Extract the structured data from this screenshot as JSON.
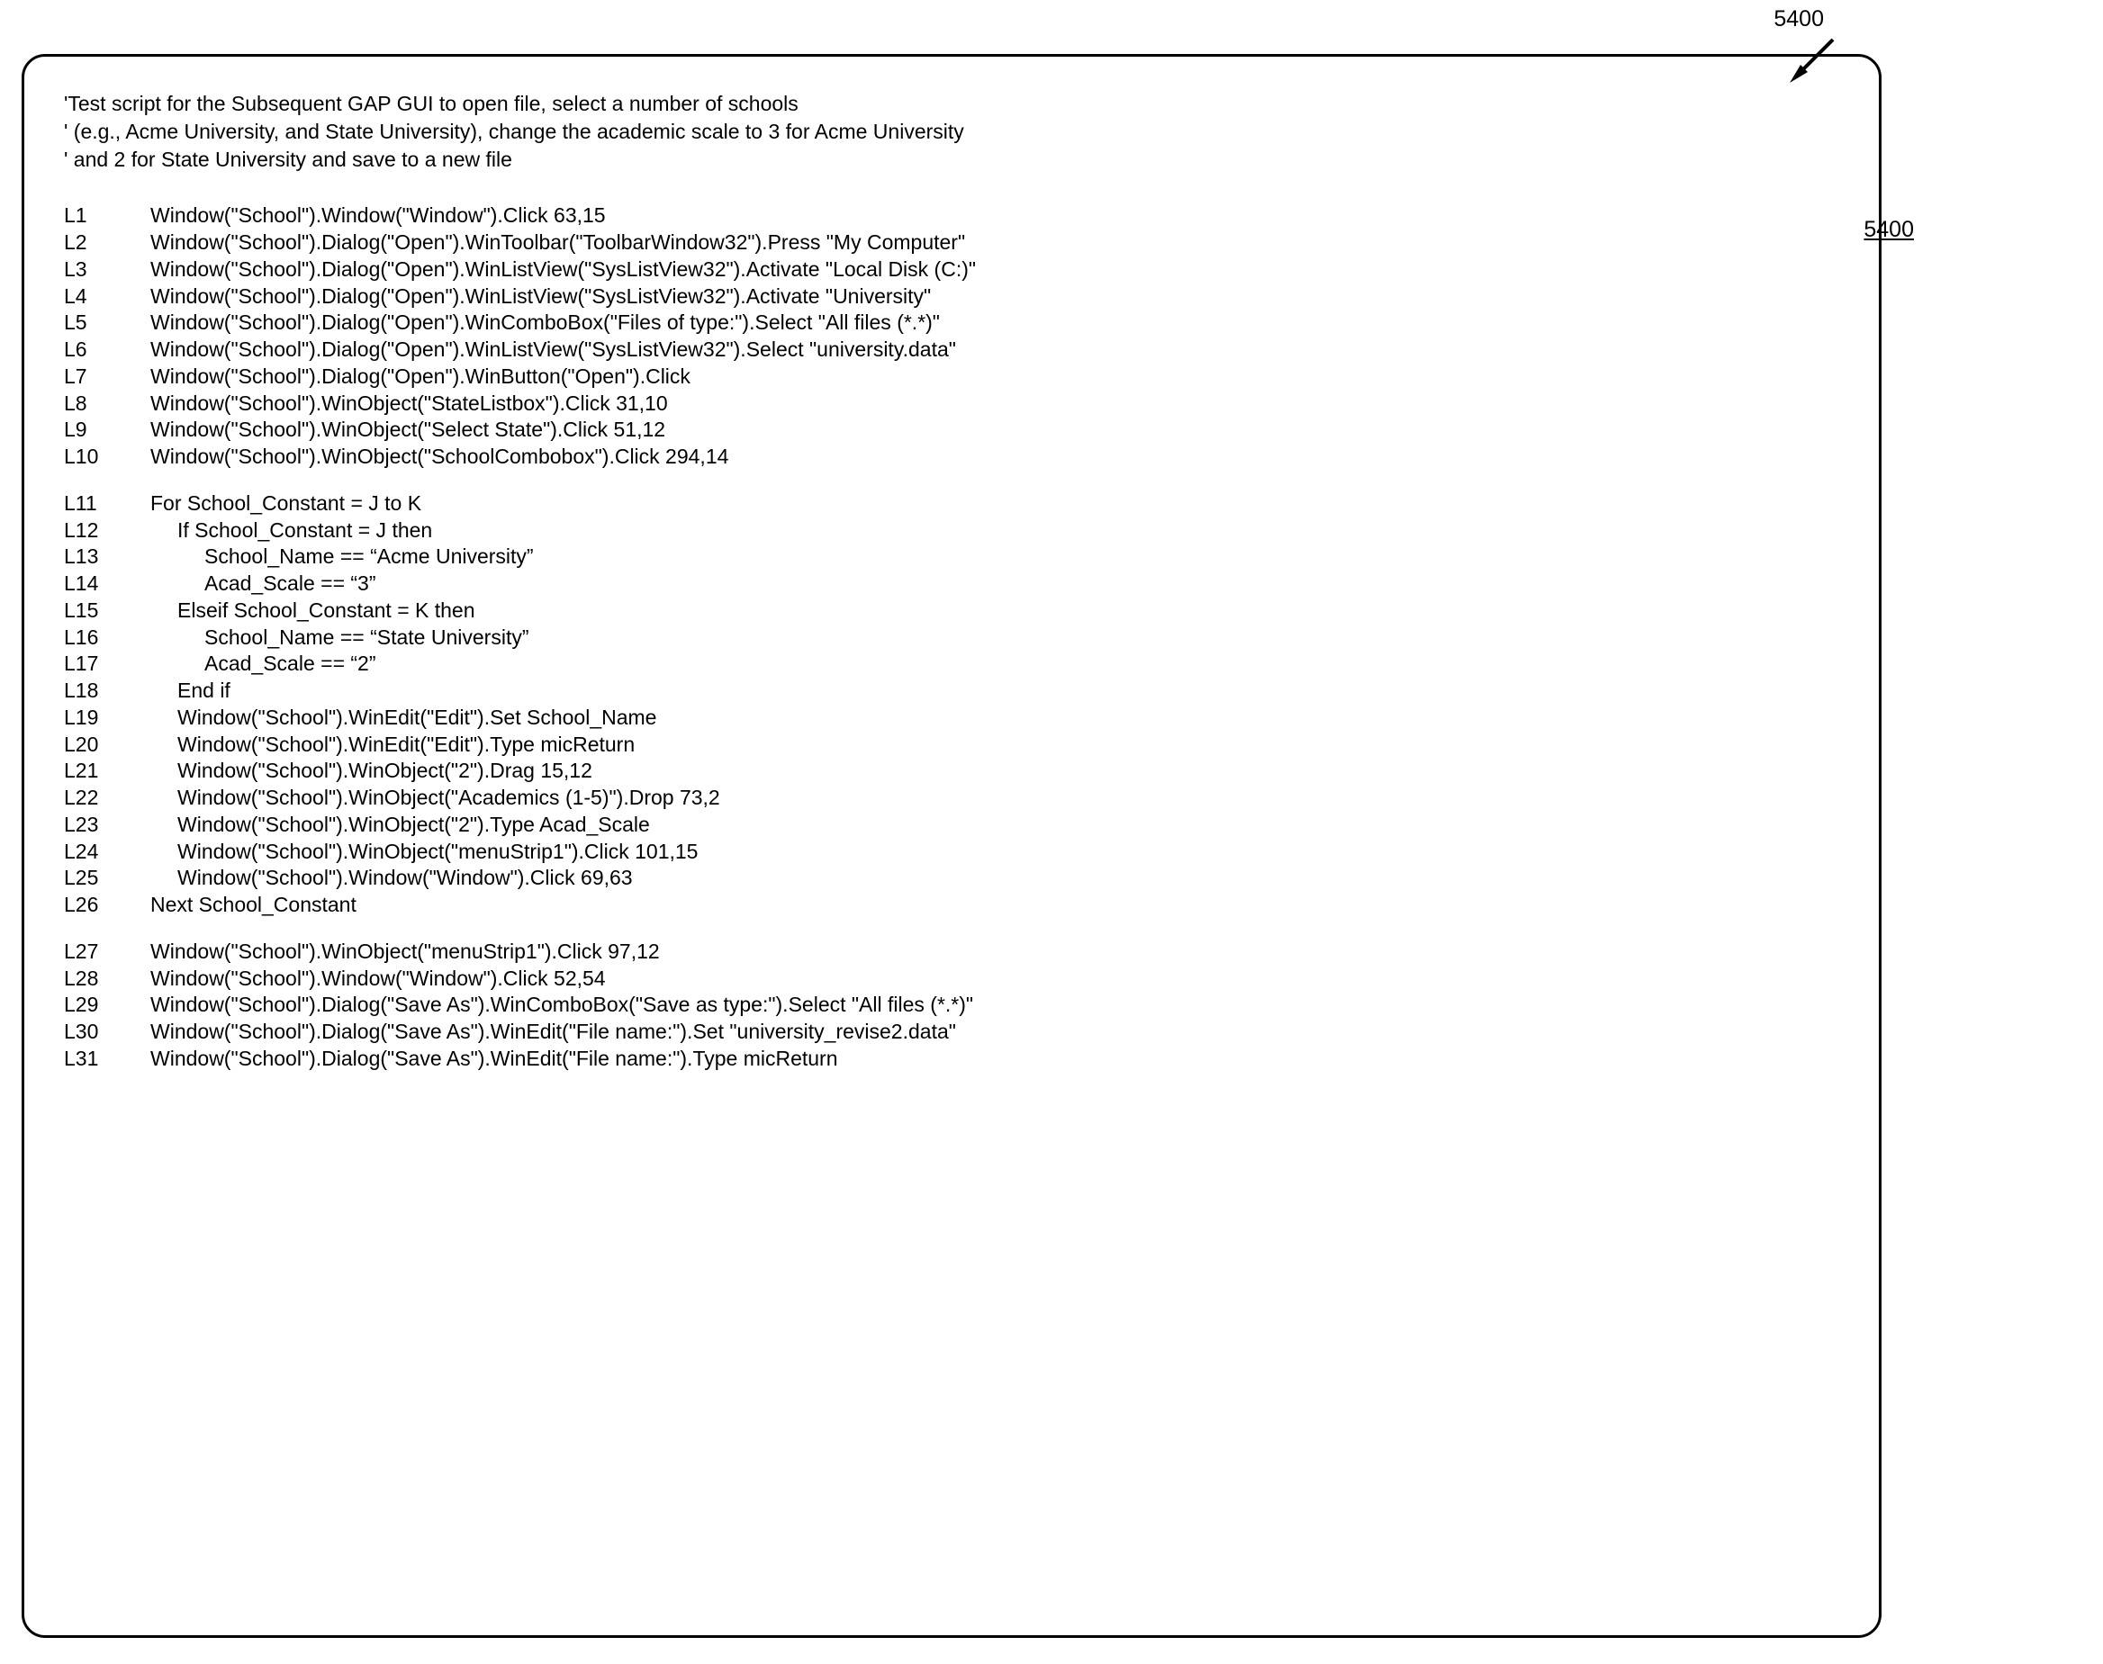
{
  "legend": {
    "top": "5400",
    "ref": "5400"
  },
  "comments": [
    "'Test script for the Subsequent GAP GUI to open file, select a number of schools",
    "' (e.g., Acme University, and State University), change the academic scale to 3 for Acme University",
    "' and 2 for State University and save to a new file"
  ],
  "blocks": [
    [
      {
        "ln": "L1",
        "indent": 0,
        "code": "Window(\"School\").Window(\"Window\").Click 63,15"
      },
      {
        "ln": "L2",
        "indent": 0,
        "code": "Window(\"School\").Dialog(\"Open\").WinToolbar(\"ToolbarWindow32\").Press \"My Computer\""
      },
      {
        "ln": "L3",
        "indent": 0,
        "code": "Window(\"School\").Dialog(\"Open\").WinListView(\"SysListView32\").Activate \"Local Disk (C:)\""
      },
      {
        "ln": "L4",
        "indent": 0,
        "code": "Window(\"School\").Dialog(\"Open\").WinListView(\"SysListView32\").Activate \"University\""
      },
      {
        "ln": "L5",
        "indent": 0,
        "code": "Window(\"School\").Dialog(\"Open\").WinComboBox(\"Files of type:\").Select \"All files (*.*)\""
      },
      {
        "ln": "L6",
        "indent": 0,
        "code": "Window(\"School\").Dialog(\"Open\").WinListView(\"SysListView32\").Select \"university.data\""
      },
      {
        "ln": "L7",
        "indent": 0,
        "code": "Window(\"School\").Dialog(\"Open\").WinButton(\"Open\").Click"
      },
      {
        "ln": "L8",
        "indent": 0,
        "code": "Window(\"School\").WinObject(\"StateListbox\").Click 31,10"
      },
      {
        "ln": "L9",
        "indent": 0,
        "code": "Window(\"School\").WinObject(\"Select State\").Click 51,12"
      },
      {
        "ln": "L10",
        "indent": 0,
        "code": "Window(\"School\").WinObject(\"SchoolCombobox\").Click 294,14"
      }
    ],
    [
      {
        "ln": "L11",
        "indent": 0,
        "code": "For School_Constant = J to K"
      },
      {
        "ln": "L12",
        "indent": 1,
        "code": "If School_Constant = J then"
      },
      {
        "ln": "L13",
        "indent": 2,
        "code": "School_Name == “Acme University”"
      },
      {
        "ln": "L14",
        "indent": 2,
        "code": "Acad_Scale == “3”"
      },
      {
        "ln": "L15",
        "indent": 1,
        "code": "Elseif School_Constant = K then"
      },
      {
        "ln": "L16",
        "indent": 2,
        "code": "School_Name == “State University”"
      },
      {
        "ln": "L17",
        "indent": 2,
        "code": "Acad_Scale == “2”"
      },
      {
        "ln": "L18",
        "indent": 1,
        "code": "End if"
      },
      {
        "ln": "L19",
        "indent": 1,
        "code": "Window(\"School\").WinEdit(\"Edit\").Set School_Name"
      },
      {
        "ln": "L20",
        "indent": 1,
        "code": "Window(\"School\").WinEdit(\"Edit\").Type  micReturn"
      },
      {
        "ln": "L21",
        "indent": 1,
        "code": "Window(\"School\").WinObject(\"2\").Drag 15,12"
      },
      {
        "ln": "L22",
        "indent": 1,
        "code": "Window(\"School\").WinObject(\"Academics (1-5)\").Drop 73,2"
      },
      {
        "ln": "L23",
        "indent": 1,
        "code": "Window(\"School\").WinObject(\"2\").Type Acad_Scale"
      },
      {
        "ln": "L24",
        "indent": 1,
        "code": "Window(\"School\").WinObject(\"menuStrip1\").Click 101,15"
      },
      {
        "ln": "L25",
        "indent": 1,
        "code": "Window(\"School\").Window(\"Window\").Click 69,63"
      },
      {
        "ln": "L26",
        "indent": 0,
        "code": "Next School_Constant"
      }
    ],
    [
      {
        "ln": "L27",
        "indent": 0,
        "code": "Window(\"School\").WinObject(\"menuStrip1\").Click 97,12"
      },
      {
        "ln": "L28",
        "indent": 0,
        "code": "Window(\"School\").Window(\"Window\").Click 52,54"
      },
      {
        "ln": "L29",
        "indent": 0,
        "code": "Window(\"School\").Dialog(\"Save As\").WinComboBox(\"Save as type:\").Select \"All files (*.*)\""
      },
      {
        "ln": "L30",
        "indent": 0,
        "code": "Window(\"School\").Dialog(\"Save As\").WinEdit(\"File name:\").Set \"university_revise2.data\""
      },
      {
        "ln": "L31",
        "indent": 0,
        "code": "Window(\"School\").Dialog(\"Save As\").WinEdit(\"File name:\").Type  micReturn"
      }
    ]
  ]
}
